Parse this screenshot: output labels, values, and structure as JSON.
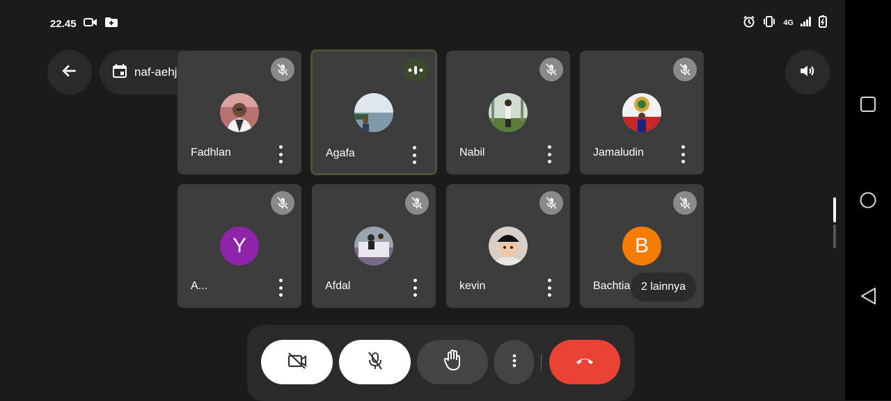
{
  "status_bar": {
    "time": "22.45",
    "network": "4G"
  },
  "meeting": {
    "code": "naf-aehj-tuj"
  },
  "participants": [
    {
      "name": "Fadhlan",
      "muted": true,
      "avatar_type": "photo"
    },
    {
      "name": "Agafa",
      "muted": false,
      "speaking": true,
      "avatar_type": "photo"
    },
    {
      "name": "Nabil",
      "muted": true,
      "avatar_type": "photo"
    },
    {
      "name": "Jamaludin",
      "muted": true,
      "avatar_type": "photo"
    },
    {
      "name": "A...",
      "muted": true,
      "avatar_type": "letter",
      "initial": "Y",
      "color": "#8e24aa"
    },
    {
      "name": "Afdal",
      "muted": true,
      "avatar_type": "photo"
    },
    {
      "name": "kevin",
      "muted": true,
      "avatar_type": "photo"
    },
    {
      "name": "Bachtiar",
      "muted": true,
      "avatar_type": "letter",
      "initial": "B",
      "color": "#f57c00"
    }
  ],
  "others": {
    "label": "2 lainnya"
  },
  "controls": {
    "camera_icon": "camera-off-icon",
    "mic_icon": "mic-off-icon",
    "hand_icon": "raise-hand-icon",
    "more_icon": "more-vert-icon",
    "end_call_icon": "end-call-icon",
    "end_call_color": "#ea4335"
  },
  "colors": {
    "background": "#1b1b1b",
    "tile": "#3c3c3c",
    "accent_letter_y": "#8e24aa",
    "accent_letter_b": "#f57c00"
  }
}
